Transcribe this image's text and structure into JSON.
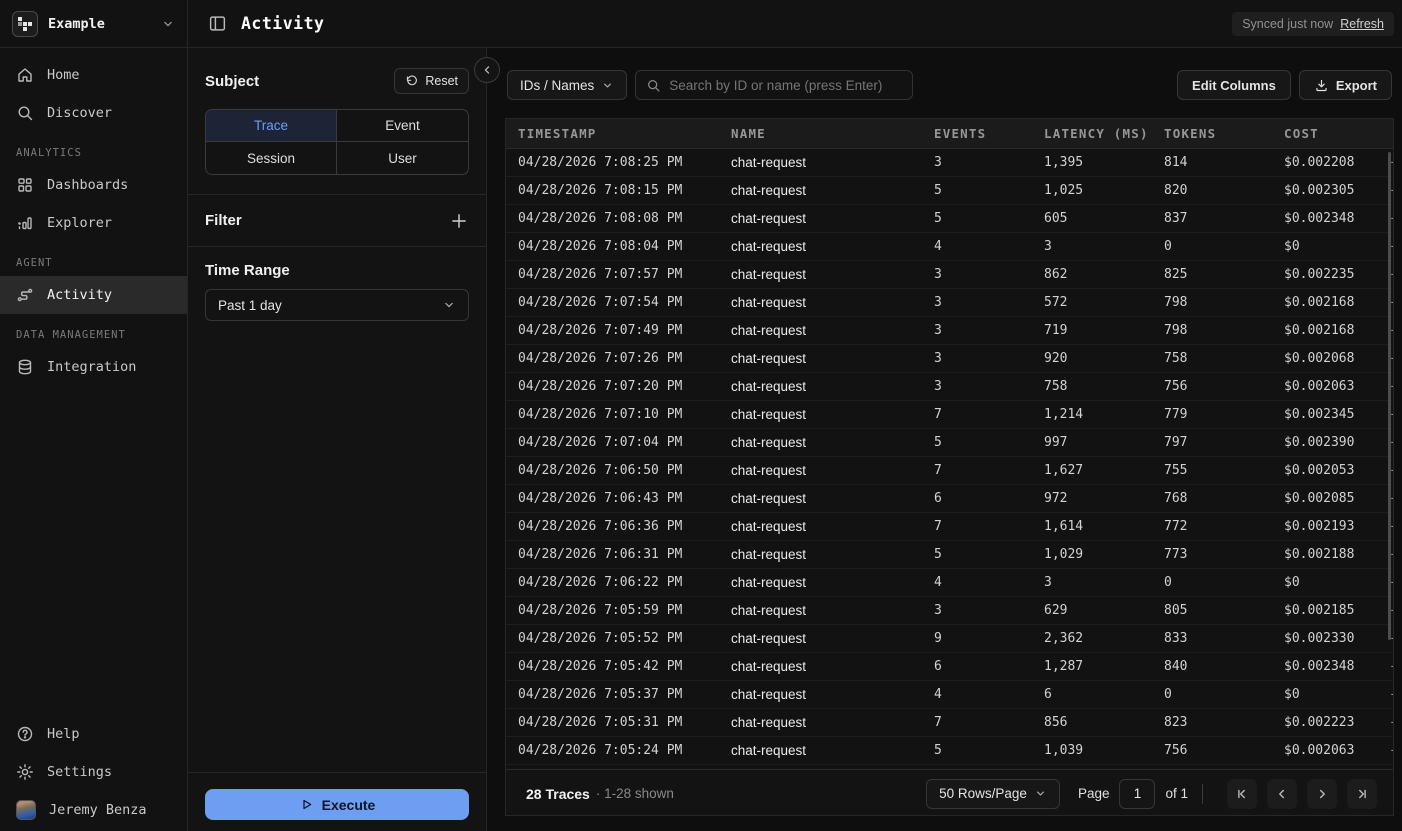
{
  "workspace": {
    "name": "Example"
  },
  "header": {
    "title": "Activity",
    "synced_text": "Synced just now",
    "refresh_label": "Refresh"
  },
  "sidebar": {
    "section_labels": {
      "analytics": "ANALYTICS",
      "agent": "AGENT",
      "data": "DATA MANAGEMENT"
    },
    "items": [
      {
        "label": "Home",
        "icon": "home-icon"
      },
      {
        "label": "Discover",
        "icon": "search-icon"
      },
      {
        "label": "Dashboards",
        "icon": "dashboards-icon"
      },
      {
        "label": "Explorer",
        "icon": "bar-chart-icon"
      },
      {
        "label": "Activity",
        "icon": "route-icon",
        "active": true
      },
      {
        "label": "Integration",
        "icon": "database-icon"
      }
    ],
    "footer": [
      {
        "label": "Help",
        "icon": "help-icon"
      },
      {
        "label": "Settings",
        "icon": "gear-icon"
      },
      {
        "label": "Jeremy Benza",
        "icon": "avatar"
      }
    ]
  },
  "filter_panel": {
    "subject_label": "Subject",
    "reset_label": "Reset",
    "tabs": [
      "Trace",
      "Event",
      "Session",
      "User"
    ],
    "active_tab": "Trace",
    "filter_label": "Filter",
    "time_range_label": "Time Range",
    "time_range_value": "Past 1 day",
    "execute_label": "Execute"
  },
  "toolbar": {
    "filter_type": "IDs / Names",
    "search_placeholder": "Search by ID or name (press Enter)",
    "edit_columns_label": "Edit Columns",
    "export_label": "Export"
  },
  "table": {
    "columns": [
      "TIMESTAMP",
      "NAME",
      "EVENTS",
      "LATENCY (MS)",
      "TOKENS",
      "COST"
    ],
    "overflow_cell": "-",
    "rows": [
      {
        "timestamp": "04/28/2026 7:08:25 PM",
        "name": "chat-request",
        "events": "3",
        "latency": "1,395",
        "tokens": "814",
        "cost": "$0.002208"
      },
      {
        "timestamp": "04/28/2026 7:08:15 PM",
        "name": "chat-request",
        "events": "5",
        "latency": "1,025",
        "tokens": "820",
        "cost": "$0.002305"
      },
      {
        "timestamp": "04/28/2026 7:08:08 PM",
        "name": "chat-request",
        "events": "5",
        "latency": "605",
        "tokens": "837",
        "cost": "$0.002348"
      },
      {
        "timestamp": "04/28/2026 7:08:04 PM",
        "name": "chat-request",
        "events": "4",
        "latency": "3",
        "tokens": "0",
        "cost": "$0"
      },
      {
        "timestamp": "04/28/2026 7:07:57 PM",
        "name": "chat-request",
        "events": "3",
        "latency": "862",
        "tokens": "825",
        "cost": "$0.002235"
      },
      {
        "timestamp": "04/28/2026 7:07:54 PM",
        "name": "chat-request",
        "events": "3",
        "latency": "572",
        "tokens": "798",
        "cost": "$0.002168"
      },
      {
        "timestamp": "04/28/2026 7:07:49 PM",
        "name": "chat-request",
        "events": "3",
        "latency": "719",
        "tokens": "798",
        "cost": "$0.002168"
      },
      {
        "timestamp": "04/28/2026 7:07:26 PM",
        "name": "chat-request",
        "events": "3",
        "latency": "920",
        "tokens": "758",
        "cost": "$0.002068"
      },
      {
        "timestamp": "04/28/2026 7:07:20 PM",
        "name": "chat-request",
        "events": "3",
        "latency": "758",
        "tokens": "756",
        "cost": "$0.002063"
      },
      {
        "timestamp": "04/28/2026 7:07:10 PM",
        "name": "chat-request",
        "events": "7",
        "latency": "1,214",
        "tokens": "779",
        "cost": "$0.002345"
      },
      {
        "timestamp": "04/28/2026 7:07:04 PM",
        "name": "chat-request",
        "events": "5",
        "latency": "997",
        "tokens": "797",
        "cost": "$0.002390"
      },
      {
        "timestamp": "04/28/2026 7:06:50 PM",
        "name": "chat-request",
        "events": "7",
        "latency": "1,627",
        "tokens": "755",
        "cost": "$0.002053"
      },
      {
        "timestamp": "04/28/2026 7:06:43 PM",
        "name": "chat-request",
        "events": "6",
        "latency": "972",
        "tokens": "768",
        "cost": "$0.002085"
      },
      {
        "timestamp": "04/28/2026 7:06:36 PM",
        "name": "chat-request",
        "events": "7",
        "latency": "1,614",
        "tokens": "772",
        "cost": "$0.002193"
      },
      {
        "timestamp": "04/28/2026 7:06:31 PM",
        "name": "chat-request",
        "events": "5",
        "latency": "1,029",
        "tokens": "773",
        "cost": "$0.002188"
      },
      {
        "timestamp": "04/28/2026 7:06:22 PM",
        "name": "chat-request",
        "events": "4",
        "latency": "3",
        "tokens": "0",
        "cost": "$0"
      },
      {
        "timestamp": "04/28/2026 7:05:59 PM",
        "name": "chat-request",
        "events": "3",
        "latency": "629",
        "tokens": "805",
        "cost": "$0.002185"
      },
      {
        "timestamp": "04/28/2026 7:05:52 PM",
        "name": "chat-request",
        "events": "9",
        "latency": "2,362",
        "tokens": "833",
        "cost": "$0.002330"
      },
      {
        "timestamp": "04/28/2026 7:05:42 PM",
        "name": "chat-request",
        "events": "6",
        "latency": "1,287",
        "tokens": "840",
        "cost": "$0.002348"
      },
      {
        "timestamp": "04/28/2026 7:05:37 PM",
        "name": "chat-request",
        "events": "4",
        "latency": "6",
        "tokens": "0",
        "cost": "$0"
      },
      {
        "timestamp": "04/28/2026 7:05:31 PM",
        "name": "chat-request",
        "events": "7",
        "latency": "856",
        "tokens": "823",
        "cost": "$0.002223"
      },
      {
        "timestamp": "04/28/2026 7:05:24 PM",
        "name": "chat-request",
        "events": "5",
        "latency": "1,039",
        "tokens": "756",
        "cost": "$0.002063"
      }
    ]
  },
  "footer": {
    "count_label": "28 Traces",
    "shown_label": "· 1-28 shown",
    "rows_per_page": "50 Rows/Page",
    "page_label": "Page",
    "page_value": "1",
    "of_label": "of 1"
  },
  "colors": {
    "accent_blue": "#6d9ef1",
    "active_tab_text": "#6f9df8",
    "active_tab_bg": "#1c2436",
    "background": "#0e0e0e"
  }
}
